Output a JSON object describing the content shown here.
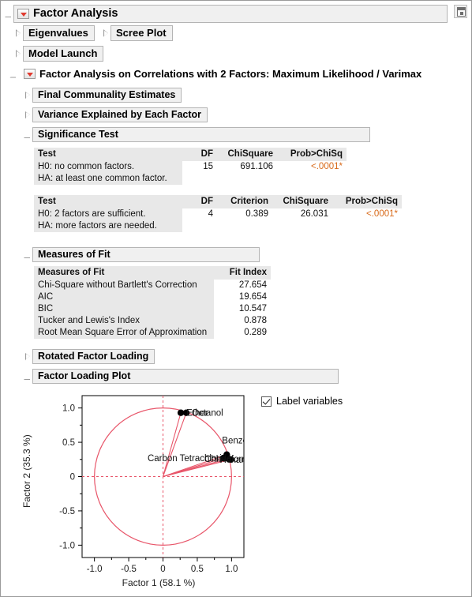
{
  "window": {
    "title": "Factor Analysis",
    "popout_icon": "popout-window-icon"
  },
  "top_nodes": [
    {
      "label": "Eigenvalues",
      "state": "closed"
    },
    {
      "label": "Scree Plot",
      "state": "closed"
    },
    {
      "label": "Model Launch",
      "state": "closed"
    }
  ],
  "main_section": {
    "title": "Factor Analysis on Correlations with 2 Factors: Maximum Likelihood / Varimax",
    "state": "open"
  },
  "sections": [
    {
      "label": "Final Communality Estimates",
      "state": "closed"
    },
    {
      "label": "Variance Explained by Each Factor",
      "state": "closed"
    },
    {
      "label": "Significance Test",
      "state": "open"
    },
    {
      "label": "Measures of Fit",
      "state": "open"
    },
    {
      "label": "Rotated Factor Loading",
      "state": "closed"
    },
    {
      "label": "Factor Loading Plot",
      "state": "open"
    }
  ],
  "significance_test": {
    "table1": {
      "headers": [
        "Test",
        "DF",
        "ChiSquare",
        "Prob>ChiSq"
      ],
      "rows": [
        {
          "h0": "H0: no common factors.",
          "ha": "HA: at least one common factor.",
          "df": "15",
          "chisquare": "691.106",
          "prob": "<.0001*"
        }
      ]
    },
    "table2": {
      "headers": [
        "Test",
        "DF",
        "Criterion",
        "ChiSquare",
        "Prob>ChiSq"
      ],
      "rows": [
        {
          "h0": "H0: 2 factors are sufficient.",
          "ha": "HA: more factors are needed.",
          "df": "4",
          "criterion": "0.389",
          "chisquare": "26.031",
          "prob": "<.0001*"
        }
      ]
    }
  },
  "measures_of_fit": {
    "headers": [
      "Measures of Fit",
      "Fit Index"
    ],
    "rows": [
      {
        "name": "Chi-Square without Bartlett's Correction",
        "value": "27.654"
      },
      {
        "name": "AIC",
        "value": "19.654"
      },
      {
        "name": "BIC",
        "value": "10.547"
      },
      {
        "name": "Tucker and Lewis's Index",
        "value": "0.878"
      },
      {
        "name": "Root Mean Square Error of Approximation",
        "value": "0.289"
      }
    ]
  },
  "plot_controls": {
    "label_variables": "Label variables",
    "label_variables_checked": true
  },
  "chart_data": {
    "type": "scatter",
    "title": "Factor Loading Plot",
    "xlabel": "Factor 1  (58.1 %)",
    "ylabel": "Factor 2  (35.3 %)",
    "xlim": [
      -1.18,
      1.18
    ],
    "ylim": [
      -1.18,
      1.18
    ],
    "xticks": [
      "-1.0",
      "-0.5",
      "0",
      "0.5",
      "1.0"
    ],
    "xtick_values": [
      -1.0,
      -0.5,
      0,
      0.5,
      1.0
    ],
    "yticks": [
      "1.0",
      "0.5",
      "0",
      "-0.5",
      "-1.0"
    ],
    "ytick_values": [
      1.0,
      0.5,
      0,
      -0.5,
      -1.0
    ],
    "grid": false,
    "reference_circle_radius": 1.0,
    "reference_lines": {
      "x": 0,
      "y": 0
    },
    "accent_color": "#e8566a",
    "point_color": "#000000",
    "points": [
      {
        "label": "Ether",
        "x": 0.26,
        "y": 0.93
      },
      {
        "label": "Octanol",
        "x": 0.34,
        "y": 0.93
      },
      {
        "label": "Benzene",
        "x": 0.93,
        "y": 0.32
      },
      {
        "label": "Carbon Tetrachloride",
        "x": 0.88,
        "y": 0.27
      },
      {
        "label": "Chloroform",
        "x": 0.95,
        "y": 0.26
      },
      {
        "label": "Hexane",
        "x": 0.99,
        "y": 0.25
      }
    ]
  }
}
